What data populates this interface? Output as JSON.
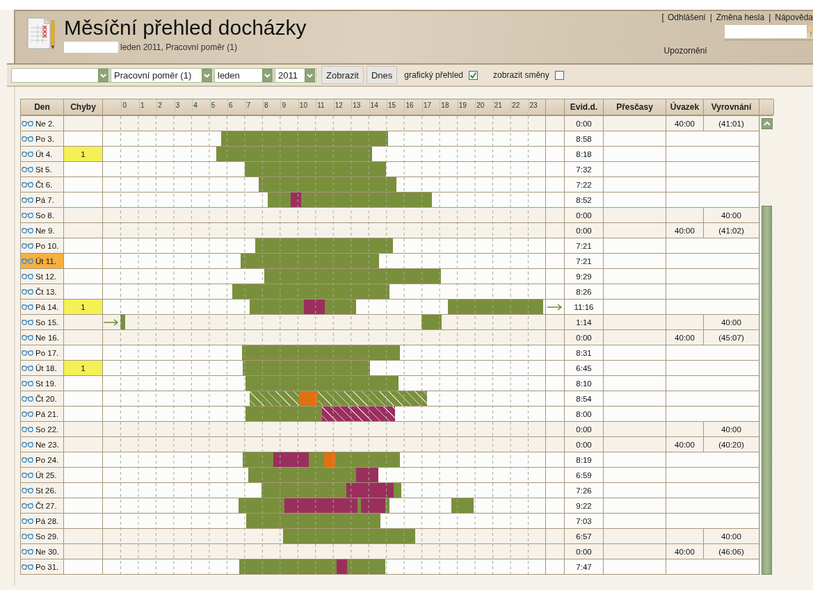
{
  "header": {
    "title": "Měsíční přehled docházky",
    "subtitle": "leden 2011, Pracovní poměr (1)",
    "open_bracket": "[",
    "links": [
      {
        "label": "Odhlášení"
      },
      {
        "separator": "|",
        "label": "Změna hesla"
      },
      {
        "separator": "|",
        "label": "Nápověda"
      }
    ],
    "notice": "Upozornění"
  },
  "toolbar": {
    "selects": [
      {
        "value": "Pracovní poměr (1)"
      },
      {
        "value": "leden"
      },
      {
        "value": "2011"
      }
    ],
    "buttons": [
      "Zobrazit",
      "Dnes"
    ],
    "checkboxes": [
      {
        "label": "grafický přehled",
        "checked": true
      },
      {
        "label": "zobrazit směny",
        "checked": false
      }
    ]
  },
  "table": {
    "columns": {
      "day": "Den",
      "errors": "Chyby",
      "evid": "Evid.d.",
      "overtime": "Přesčasy",
      "load": "Úvazek",
      "balance": "Vyrovnání"
    },
    "hours": [
      "0",
      "1",
      "2",
      "3",
      "4",
      "5",
      "6",
      "7",
      "8",
      "9",
      "10",
      "11",
      "12",
      "13",
      "14",
      "15",
      "16",
      "17",
      "18",
      "19",
      "20",
      "21",
      "22",
      "23"
    ],
    "rows": [
      {
        "day": "Ne 2.",
        "kind": "weekend",
        "selected": false,
        "blocks": [],
        "evid": "0:00",
        "load": "40:00",
        "balance": "(41:01)"
      },
      {
        "day": "Po 3.",
        "kind": "workday",
        "selected": false,
        "blocks": [
          {
            "kind": "empty"
          },
          {
            "kind": "work"
          }
        ],
        "evid": "8:58"
      },
      {
        "day": "Út 4.",
        "kind": "workday",
        "selected": false,
        "errors": "1",
        "blocks": [
          {
            "kind": "empty"
          },
          {
            "kind": "work"
          }
        ],
        "evid": "8:18"
      },
      {
        "day": "St 5.",
        "kind": "workday",
        "selected": false,
        "blocks": [
          {
            "kind": "empty"
          },
          {
            "kind": "work"
          }
        ],
        "evid": "7:32"
      },
      {
        "day": "Čt 6.",
        "kind": "workday",
        "selected": false,
        "blocks": [
          {
            "kind": "empty"
          },
          {
            "kind": "work"
          }
        ],
        "evid": "7:22"
      },
      {
        "day": "Pá 7.",
        "kind": "workday",
        "selected": false,
        "blocks": [
          {
            "kind": "empty"
          },
          {
            "kind": "work"
          },
          {
            "kind": "break"
          },
          {
            "kind": "work"
          }
        ],
        "evid": "8:52"
      },
      {
        "day": "So 8.",
        "kind": "weekend",
        "selected": false,
        "blocks": [],
        "evid": "0:00",
        "balance": "40:00"
      },
      {
        "day": "Ne 9.",
        "kind": "weekend",
        "selected": false,
        "blocks": [],
        "evid": "0:00",
        "load": "40:00",
        "balance": "(41:02)"
      },
      {
        "day": "Po 10.",
        "kind": "workday",
        "selected": false,
        "blocks": [
          {
            "kind": "empty"
          },
          {
            "kind": "work"
          }
        ],
        "evid": "7:21"
      },
      {
        "day": "Út 11.",
        "kind": "workday",
        "selected": true,
        "blocks": [
          {
            "kind": "empty"
          },
          {
            "kind": "work"
          }
        ],
        "evid": "7:21"
      },
      {
        "day": "St 12.",
        "kind": "workday",
        "selected": false,
        "blocks": [
          {
            "kind": "empty"
          },
          {
            "kind": "work"
          }
        ],
        "evid": "9:29"
      },
      {
        "day": "Čt 13.",
        "kind": "workday",
        "selected": false,
        "blocks": [
          {
            "kind": "empty"
          },
          {
            "kind": "work"
          }
        ],
        "evid": "8:26"
      },
      {
        "day": "Pá 14.",
        "kind": "workday",
        "selected": false,
        "errors": "1",
        "to_next": true,
        "blocks": [
          {
            "kind": "empty"
          },
          {
            "kind": "work"
          },
          {
            "kind": "break"
          },
          {
            "kind": "work"
          },
          {
            "kind": "empty"
          },
          {
            "kind": "work"
          }
        ],
        "evid": "11:16"
      },
      {
        "day": "So 15.",
        "kind": "weekend",
        "selected": false,
        "from_prev": true,
        "blocks": [
          {
            "kind": "empty"
          },
          {
            "kind": "work"
          },
          {
            "kind": "empty"
          },
          {
            "kind": "work"
          }
        ],
        "evid": "1:14",
        "balance": "40:00"
      },
      {
        "day": "Ne 16.",
        "kind": "weekend",
        "selected": false,
        "blocks": [],
        "evid": "0:00",
        "load": "40:00",
        "balance": "(45:07)"
      },
      {
        "day": "Po 17.",
        "kind": "workday",
        "selected": false,
        "blocks": [
          {
            "kind": "empty"
          },
          {
            "kind": "work"
          }
        ],
        "evid": "8:31"
      },
      {
        "day": "Út 18.",
        "kind": "workday",
        "selected": false,
        "errors": "1",
        "blocks": [
          {
            "kind": "empty"
          },
          {
            "kind": "work"
          }
        ],
        "evid": "6:45"
      },
      {
        "day": "St 19.",
        "kind": "workday",
        "selected": false,
        "blocks": [
          {
            "kind": "empty"
          },
          {
            "kind": "work"
          }
        ],
        "evid": "8:10"
      },
      {
        "day": "Čt 20.",
        "kind": "workday",
        "selected": false,
        "blocks": [
          {
            "kind": "empty"
          },
          {
            "kind": "work_hatched"
          },
          {
            "kind": "absence"
          },
          {
            "kind": "work_hatched"
          }
        ],
        "evid": "8:54"
      },
      {
        "day": "Pá 21.",
        "kind": "workday",
        "selected": false,
        "blocks": [
          {
            "kind": "empty"
          },
          {
            "kind": "work"
          },
          {
            "kind": "break_hatched"
          }
        ],
        "evid": "8:00"
      },
      {
        "day": "So 22.",
        "kind": "weekend",
        "selected": false,
        "blocks": [],
        "evid": "0:00",
        "balance": "40:00"
      },
      {
        "day": "Ne 23.",
        "kind": "weekend",
        "selected": false,
        "blocks": [],
        "evid": "0:00",
        "load": "40:00",
        "balance": "(40:20)"
      },
      {
        "day": "Po 24.",
        "kind": "workday",
        "selected": false,
        "blocks": [
          {
            "kind": "empty"
          },
          {
            "kind": "work"
          },
          {
            "kind": "break"
          },
          {
            "kind": "work"
          },
          {
            "kind": "absence"
          },
          {
            "kind": "work"
          }
        ],
        "evid": "8:19"
      },
      {
        "day": "Út 25.",
        "kind": "workday",
        "selected": false,
        "blocks": [
          {
            "kind": "empty"
          },
          {
            "kind": "work"
          },
          {
            "kind": "break"
          }
        ],
        "evid": "6:59"
      },
      {
        "day": "St 26.",
        "kind": "workday",
        "selected": false,
        "blocks": [
          {
            "kind": "empty"
          },
          {
            "kind": "work"
          },
          {
            "kind": "break"
          },
          {
            "kind": "work"
          }
        ],
        "evid": "7:26"
      },
      {
        "day": "Čt 27.",
        "kind": "workday",
        "selected": false,
        "blocks": [
          {
            "kind": "empty"
          },
          {
            "kind": "work"
          },
          {
            "kind": "break"
          },
          {
            "kind": "work"
          },
          {
            "kind": "break"
          },
          {
            "kind": "work"
          },
          {
            "kind": "empty"
          },
          {
            "kind": "work"
          }
        ],
        "evid": "9:22"
      },
      {
        "day": "Pá 28.",
        "kind": "workday",
        "selected": false,
        "blocks": [
          {
            "kind": "empty"
          },
          {
            "kind": "work"
          }
        ],
        "evid": "7:03"
      },
      {
        "day": "So 29.",
        "kind": "weekend",
        "selected": false,
        "blocks": [
          {
            "kind": "empty"
          },
          {
            "kind": "work"
          }
        ],
        "evid": "6:57",
        "balance": "40:00"
      },
      {
        "day": "Ne 30.",
        "kind": "weekend",
        "selected": false,
        "blocks": [],
        "evid": "0:00",
        "load": "40:00",
        "balance": "(46:06)"
      },
      {
        "day": "Po 31.",
        "kind": "workday",
        "selected": false,
        "blocks": [
          {
            "kind": "empty"
          },
          {
            "kind": "work"
          },
          {
            "kind": "break"
          },
          {
            "kind": "work"
          }
        ],
        "evid": "7:47"
      }
    ]
  }
}
